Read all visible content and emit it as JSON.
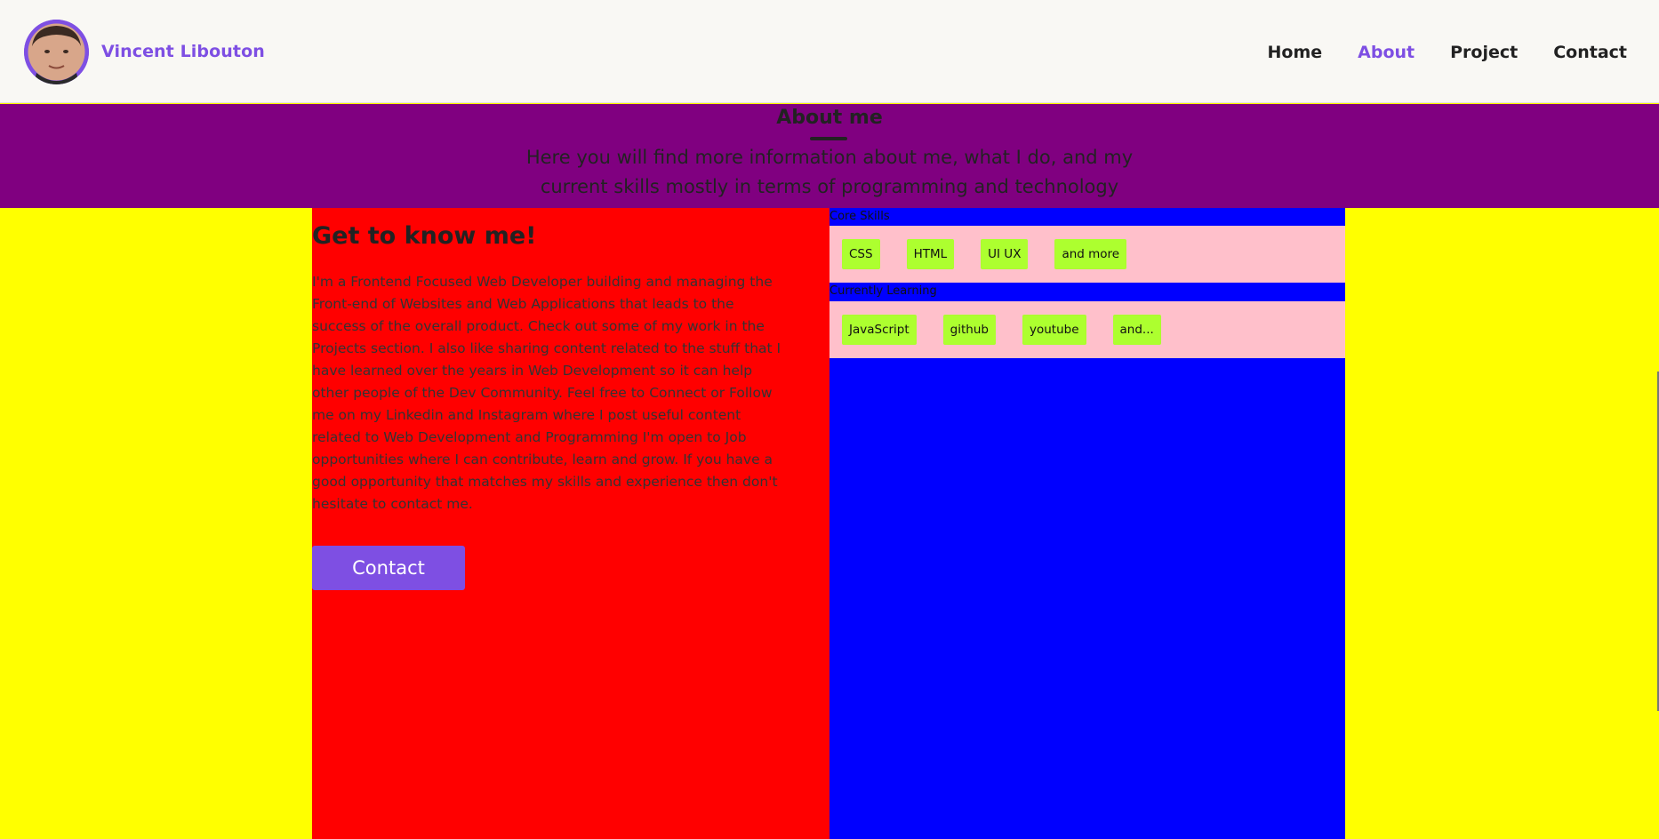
{
  "header": {
    "brand_name": "Vincent Libouton",
    "nav": [
      {
        "label": "Home"
      },
      {
        "label": "About"
      },
      {
        "label": "Project"
      },
      {
        "label": "Contact"
      }
    ],
    "active_nav": "About"
  },
  "banner": {
    "title": "About me",
    "subtitle": "Here you will find more information about me, what I do, and my current skills mostly in terms of programming and technology"
  },
  "about": {
    "heading": "Get to know me!",
    "text": "I'm a Frontend Focused Web Developer building and managing the Front-end of Websites and Web Applications that leads to the success of the overall product. Check out some of my work in the Projects section. I also like sharing content related to the stuff that I have learned over the years in Web Development so it can help other people of the Dev Community. Feel free to Connect or Follow me on my Linkedin and Instagram where I post useful content related to Web Development and Programming I'm open to Job opportunities where I can contribute, learn and grow. If you have a good opportunity that matches my skills and experience then don't hesitate to contact me.",
    "contact_button": "Contact"
  },
  "skills": {
    "core_label": "Core Skills",
    "core": [
      "CSS",
      "HTML",
      "UI UX",
      "and more"
    ],
    "learning_label": "Currently Learning",
    "learning": [
      "JavaScript",
      "github",
      "youtube",
      "and..."
    ]
  },
  "colors": {
    "accent": "#7e4fe3",
    "banner_bg": "#800080",
    "page_bg": "#ffff00",
    "left_col_bg": "#ff0000",
    "right_col_bg": "#0000ff",
    "skills_box_bg": "#ffc0cb",
    "chip_bg": "#adff2f"
  }
}
